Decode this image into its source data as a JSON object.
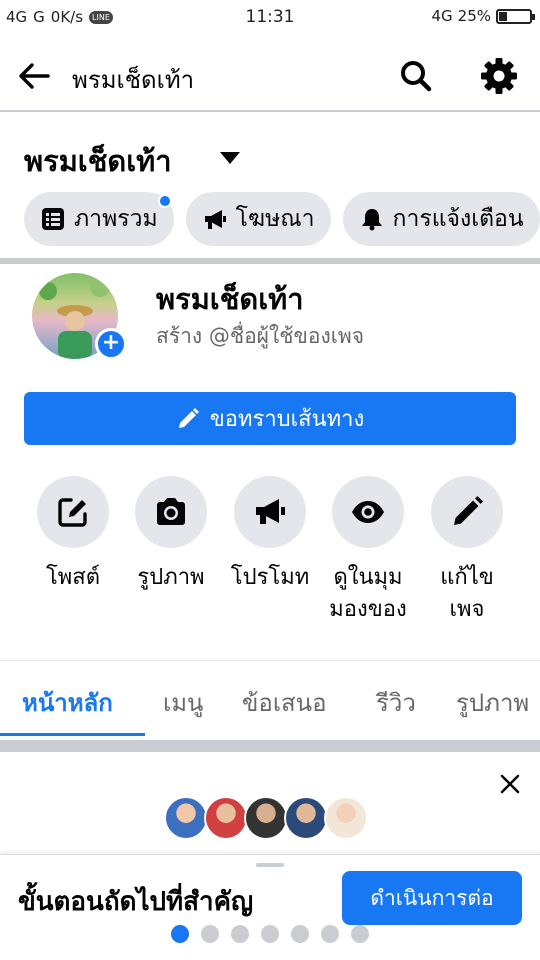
{
  "status_bar": {
    "signal_left": "4G  G",
    "net_speed": "0K/s",
    "app_badge": "LINE",
    "time": "11:31",
    "network_right": "4G",
    "battery": "25%",
    "battery_level": 0.25
  },
  "app_bar": {
    "title": "พรมเช็ดเท้า"
  },
  "page_header": {
    "name": "พรมเช็ดเท้า",
    "chips": [
      {
        "icon": "list-icon",
        "label": "ภาพรวม",
        "has_dot": true
      },
      {
        "icon": "megaphone-icon",
        "label": "โฆษณา",
        "has_dot": false
      },
      {
        "icon": "bell-icon",
        "label": "การแจ้งเตือน",
        "has_dot": false
      }
    ]
  },
  "profile": {
    "name": "พรมเช็ดเท้า",
    "handle": "สร้าง @ชื่อผู้ใช้ของเพจ",
    "directions_label": "ขอทราบเส้นทาง"
  },
  "actions": [
    {
      "icon": "compose-icon",
      "label": "โพสต์"
    },
    {
      "icon": "camera-icon",
      "label": "รูปภาพ"
    },
    {
      "icon": "megaphone-icon",
      "label": "โปรโมท"
    },
    {
      "icon": "eye-icon",
      "label": "ดูในมุม\nมองของ"
    },
    {
      "icon": "pencil-icon",
      "label": "แก้ไข\nเพจ"
    }
  ],
  "tabs": [
    {
      "label": "หน้าหลัก",
      "active": true
    },
    {
      "label": "เมนู",
      "active": false
    },
    {
      "label": "ข้อเสนอ",
      "active": false
    },
    {
      "label": "รีวิว",
      "active": false
    },
    {
      "label": "รูปภาพ",
      "active": false
    }
  ],
  "bottom_sheet": {
    "title": "ขั้นตอนถัดไปที่สำคัญ",
    "continue_label": "ดำเนินการต่อ",
    "page_count": 7,
    "active_page": 1
  },
  "colors": {
    "accent": "#1877f2",
    "chip_bg": "#e4e6eb",
    "secondary_text": "#65676b"
  }
}
